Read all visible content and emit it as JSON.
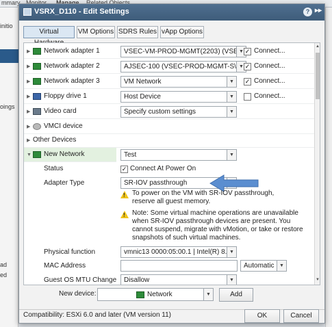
{
  "background": {
    "menu_items": [
      "mmary",
      "Monitor",
      "Manage",
      "Related Objects"
    ],
    "left_labels": [
      "initio",
      "oings",
      "ad",
      "ed"
    ]
  },
  "dialog": {
    "title": "VSRX_D110 - Edit Settings",
    "tabs": [
      "Virtual Hardware",
      "VM Options",
      "SDRS Rules",
      "vApp Options"
    ],
    "selected_tab": "Virtual Hardware",
    "devices": [
      {
        "label": "Network adapter 1",
        "value": "VSEC-VM-PROD-MGMT(2203) (VSE",
        "connect_label": "Connect...",
        "connected": true,
        "icon": "network-adapter-icon"
      },
      {
        "label": "Network adapter 2",
        "value": "AJSEC-100 (VSEC-PROD-MGMT-S\\",
        "connect_label": "Connect...",
        "connected": true,
        "icon": "network-adapter-icon"
      },
      {
        "label": "Network adapter 3",
        "value": "VM Network",
        "connect_label": "Connect...",
        "connected": true,
        "icon": "network-adapter-icon"
      },
      {
        "label": "Floppy drive 1",
        "value": "Host Device",
        "connect_label": "Connect...",
        "connected": false,
        "icon": "floppy-drive-icon"
      },
      {
        "label": "Video card",
        "value": "Specify custom settings",
        "icon": "video-card-icon"
      },
      {
        "label": "VMCI device",
        "icon": "vmci-device-icon"
      },
      {
        "label": "Other Devices"
      }
    ],
    "new_network": {
      "label": "New Network",
      "value": "Test",
      "status_label": "Status",
      "status_checkbox_label": "Connect At Power On",
      "status_checked": true,
      "adapter_type_label": "Adapter Type",
      "adapter_type_value": "SR-IOV passthrough",
      "warning_1": "To power on the VM with SR-IOV passthrough, reserve all guest memory.",
      "warning_2": "Note: Some virtual machine operations are unavailable when SR-IOV passthrough devices are present. You cannot suspend, migrate with vMotion, or take or restore snapshots of such virtual machines.",
      "physical_function_label": "Physical function",
      "physical_function_value": "vmnic13 0000:05:00.1 | Intel(R) 8...",
      "mac_address_label": "MAC Address",
      "mac_address_value": "",
      "mac_mode_value": "Automatic",
      "mtu_label": "Guest OS MTU Change",
      "mtu_value": "Disallow"
    },
    "new_device_label": "New device:",
    "new_device_value": "Network",
    "add_button": "Add",
    "compatibility": "Compatibility: ESXi 6.0 and later (VM version 11)",
    "ok_button": "OK",
    "cancel_button": "Cancel"
  },
  "colors": {
    "titlebar": "#4f6f8f",
    "selected_row": "#e3f1e0",
    "arrow": "#5b8ed0",
    "warning": "#f0c419"
  }
}
